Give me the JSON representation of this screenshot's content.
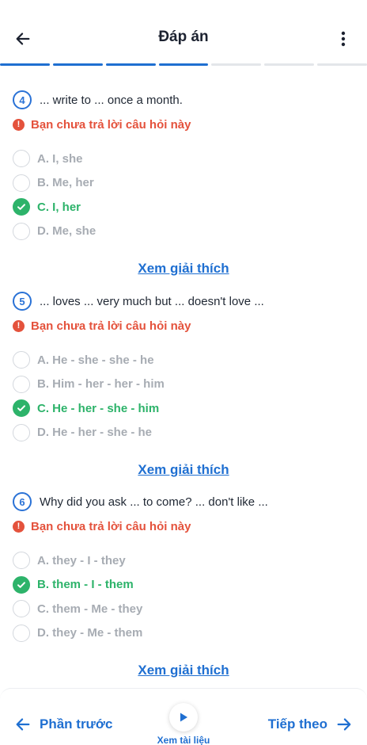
{
  "header": {
    "title": "Đáp án",
    "progress_total": 7,
    "progress_done": 4
  },
  "questions": [
    {
      "number": "4",
      "text": "... write to ... once a month.",
      "warning": "Bạn chưa trả lời câu hỏi này",
      "options": [
        {
          "label": "A. I, she",
          "correct": false
        },
        {
          "label": "B. Me, her",
          "correct": false
        },
        {
          "label": "C. I, her",
          "correct": true
        },
        {
          "label": "D. Me, she",
          "correct": false
        }
      ],
      "explain_label": "Xem giải thích"
    },
    {
      "number": "5",
      "text": "... loves ... very much but ... doesn't love ...",
      "warning": "Bạn chưa trả lời câu hỏi này",
      "options": [
        {
          "label": "A. He - she - she - he",
          "correct": false
        },
        {
          "label": "B. Him - her - her - him",
          "correct": false
        },
        {
          "label": "C. He - her - she - him",
          "correct": true
        },
        {
          "label": "D. He - her -  she - he",
          "correct": false
        }
      ],
      "explain_label": "Xem giải thích"
    },
    {
      "number": "6",
      "text": "Why did you ask ... to come? ... don't like ...",
      "warning": "Bạn chưa trả lời câu hỏi này",
      "options": [
        {
          "label": "A. they - I -  they",
          "correct": false
        },
        {
          "label": "B. them - I -  them",
          "correct": true
        },
        {
          "label": "C. them -  Me -  they",
          "correct": false
        },
        {
          "label": "D. they - Me - them",
          "correct": false
        }
      ],
      "explain_label": "Xem giải thích"
    }
  ],
  "footer": {
    "prev_label": "Phần trước",
    "doc_label": "Xem tài liệu",
    "next_label": "Tiếp theo"
  },
  "colors": {
    "primary": "#1f6fd1",
    "correct": "#2db36a",
    "warning": "#e4523c",
    "muted": "#a7acb3"
  },
  "icons": {
    "back": "arrow-left-icon",
    "more": "more-vertical-icon",
    "warn": "alert-circle-icon",
    "check": "check-icon",
    "play": "play-icon",
    "prev": "arrow-left-icon",
    "next": "arrow-right-icon"
  }
}
